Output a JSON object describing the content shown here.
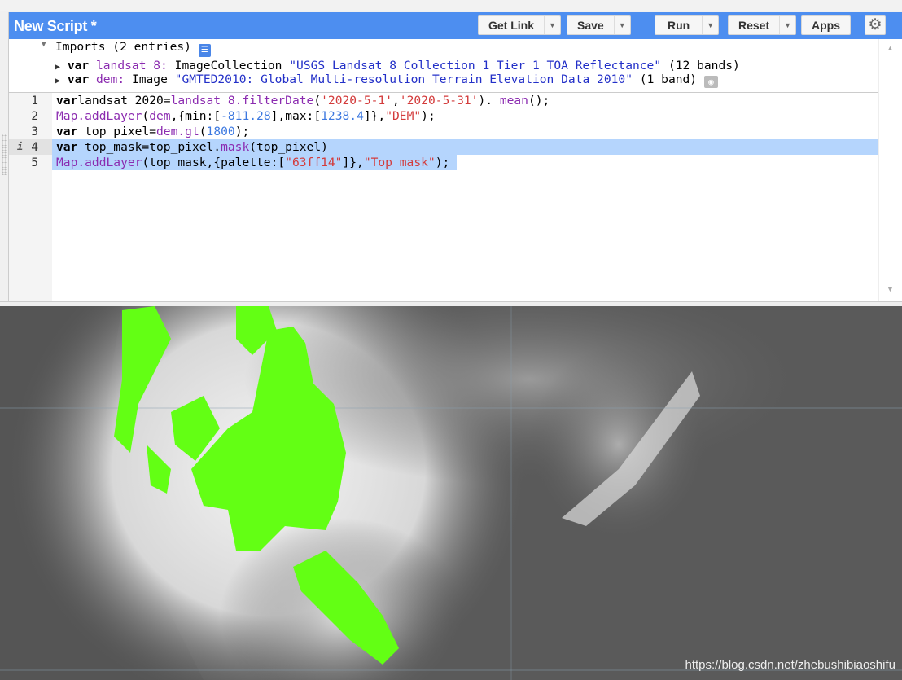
{
  "header": {
    "title": "New Script *",
    "buttons": [
      {
        "label": "Get Link",
        "dropdown": true
      },
      {
        "label": "Save",
        "dropdown": true
      },
      {
        "label": "Run",
        "dropdown": true
      },
      {
        "label": "Reset",
        "dropdown": true
      },
      {
        "label": "Apps",
        "dropdown": false
      }
    ],
    "settings_icon": "gear-icon",
    "color": "#4d8ef0"
  },
  "imports": {
    "summary": "Imports (2 entries)",
    "entries": [
      {
        "keyword": "var",
        "name": "landsat_8:",
        "type": "ImageCollection",
        "desc": "\"USGS Landsat 8 Collection 1 Tier 1 TOA Reflectance\"",
        "extra": "(12 bands)"
      },
      {
        "keyword": "var",
        "name": "dem:",
        "type": "Image",
        "desc": "\"GMTED2010: Global Multi-resolution Terrain Elevation Data 2010\"",
        "extra": "(1 band)"
      }
    ]
  },
  "code": {
    "line_numbers": [
      "1",
      "2",
      "3",
      "4",
      "5"
    ],
    "info_marker": "i",
    "lines": [
      [
        [
          "kw",
          "var"
        ],
        [
          "",
          "landsat_2020="
        ],
        [
          "pu",
          "landsat_8.filterDate"
        ],
        [
          "",
          "("
        ],
        [
          "st",
          "'2020-5-1'"
        ],
        [
          "",
          ","
        ],
        [
          "st",
          "'2020-5-31'"
        ],
        [
          "",
          "). "
        ],
        [
          "pu",
          "mean"
        ],
        [
          "",
          "();"
        ]
      ],
      [
        [
          "pu",
          "Map.addLayer"
        ],
        [
          "",
          "("
        ],
        [
          "pu",
          "dem"
        ],
        [
          "",
          ",{min:["
        ],
        [
          "nu",
          "-811.28"
        ],
        [
          "",
          "],max:["
        ],
        [
          "nu",
          "1238.4"
        ],
        [
          "",
          "]},"
        ],
        [
          "st",
          "\"DEM\""
        ],
        [
          "",
          ");"
        ]
      ],
      [
        [
          "kw",
          "var"
        ],
        [
          "",
          " top_pixel="
        ],
        [
          "pu",
          "dem.gt"
        ],
        [
          "",
          "("
        ],
        [
          "nu",
          "1800"
        ],
        [
          "",
          ");"
        ]
      ],
      [
        [
          "kw",
          "var"
        ],
        [
          "",
          " top_mask=top_pixel."
        ],
        [
          "pu",
          "mask"
        ],
        [
          "",
          "(top_pixel)"
        ]
      ],
      [
        [
          "pu",
          "Map.addLayer"
        ],
        [
          "",
          "(top_mask,{palette:["
        ],
        [
          "st",
          "\"63ff14\""
        ],
        [
          "",
          "]},"
        ],
        [
          "st",
          "\"Top_mask\""
        ],
        [
          "",
          ");"
        ]
      ]
    ],
    "highlight_color": "#b5d5fd"
  },
  "map": {
    "mask_color": "#63ff14",
    "watermark": "https://blog.csdn.net/zhebushibiaoshifu"
  }
}
